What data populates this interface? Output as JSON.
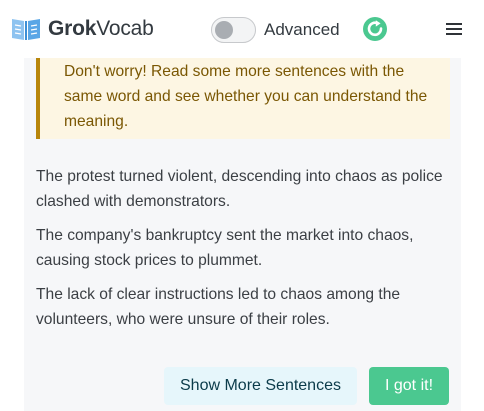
{
  "header": {
    "brand_bold": "Grok",
    "brand_regular": "Vocab",
    "advanced_label": "Advanced",
    "advanced_enabled": false,
    "icons": {
      "logo": "open-book-icon",
      "refresh": "refresh-icon",
      "menu": "hamburger-menu-icon"
    }
  },
  "notice": {
    "text": "Don't worry! Read some more sentences with the same word and see whether you can understand the meaning."
  },
  "sentences": [
    "The protest turned violent, descending into chaos as police clashed with demonstrators.",
    "The company's bankruptcy sent the market into chaos, causing stock prices to plummet.",
    "The lack of clear instructions led to chaos among the volunteers, who were unsure of their roles."
  ],
  "actions": {
    "show_more_label": "Show More Sentences",
    "got_it_label": "I got it!"
  },
  "colors": {
    "accent_green": "#4bc890",
    "notice_border": "#b8860b",
    "notice_bg": "#fdf6e3",
    "logo_blue": "#5aa6e6"
  }
}
